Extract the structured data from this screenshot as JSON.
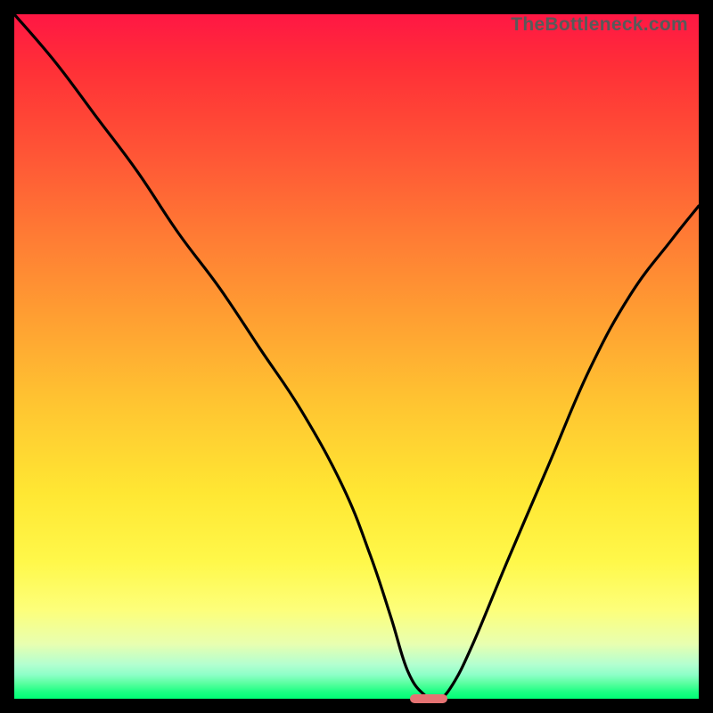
{
  "attribution": {
    "text": "TheBottleneck.com"
  },
  "chart_data": {
    "type": "line",
    "title": "",
    "xlabel": "",
    "ylabel": "",
    "xlim": [
      0,
      100
    ],
    "ylim": [
      0,
      100
    ],
    "grid": false,
    "legend": false,
    "background": "vertical-gradient",
    "colors": {
      "top": "#ff1744",
      "mid": "#ffe733",
      "bottom": "#00ff76",
      "frame": "#000000",
      "curve": "#000000",
      "marker": "#e57373"
    },
    "series": [
      {
        "name": "bottleneck-curve",
        "x": [
          0,
          6,
          12,
          18,
          24,
          30,
          36,
          42,
          48,
          52,
          55,
          57.5,
          60,
          62,
          64,
          67,
          72,
          78,
          84,
          90,
          96,
          100
        ],
        "y": [
          100,
          93,
          85,
          77,
          68,
          60,
          51,
          42,
          31,
          21,
          12,
          4,
          0.5,
          0,
          2,
          8,
          20,
          34,
          48,
          59,
          67,
          72
        ]
      }
    ],
    "marker": {
      "name": "optimal-point",
      "x_center": 60.5,
      "y_center": 0,
      "width_pct": 5.5,
      "height_pct": 1.3
    }
  }
}
